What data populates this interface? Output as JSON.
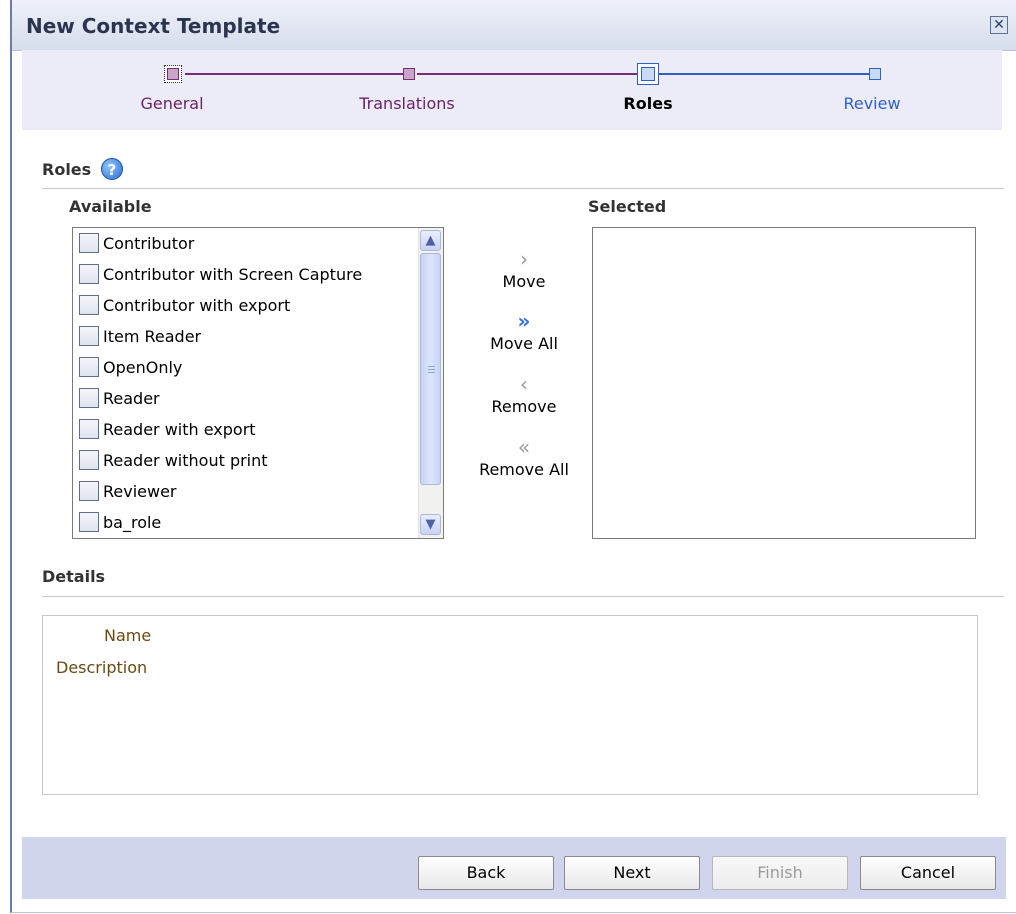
{
  "dialog": {
    "title": "New Context Template",
    "close_glyph": "✕"
  },
  "train": {
    "steps": [
      {
        "label": "General",
        "state": "visited"
      },
      {
        "label": "Translations",
        "state": "visited"
      },
      {
        "label": "Roles",
        "state": "current"
      },
      {
        "label": "Review",
        "state": "unvisited"
      }
    ],
    "colors": {
      "visited": "#7a2a78",
      "current": "#2f5fc7",
      "unvisited": "#2f5fc7"
    }
  },
  "roles": {
    "heading": "Roles",
    "help_glyph": "?",
    "available_label": "Available",
    "selected_label": "Selected",
    "available_items": [
      "Contributor",
      "Contributor with Screen Capture",
      "Contributor with export",
      "Item Reader",
      "OpenOnly",
      "Reader",
      "Reader with export",
      "Reader without print",
      "Reviewer",
      "ba_role"
    ],
    "selected_items": [],
    "shuttle": {
      "move": "Move",
      "move_all": "Move All",
      "remove": "Remove",
      "remove_all": "Remove All"
    }
  },
  "details": {
    "heading": "Details",
    "name_label": "Name",
    "description_label": "Description"
  },
  "footer": {
    "back": "Back",
    "next": "Next",
    "finish": "Finish",
    "cancel": "Cancel"
  }
}
